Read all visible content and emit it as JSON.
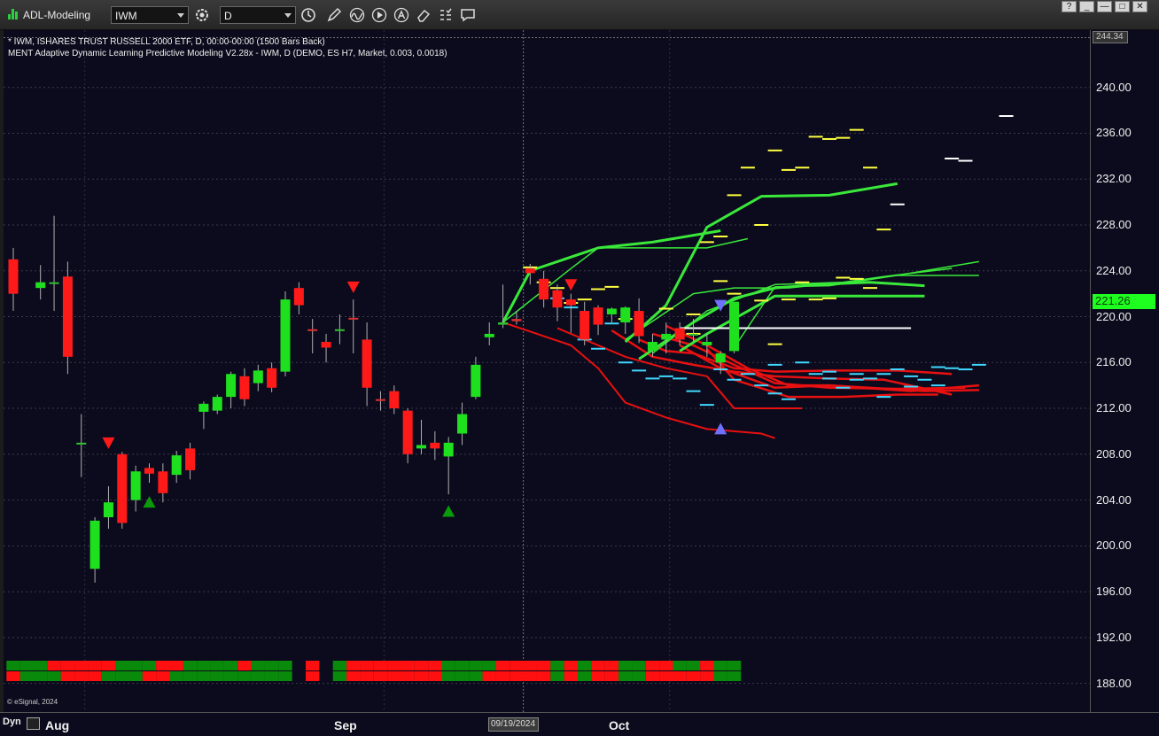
{
  "window": {
    "title": "ADL-Modeling",
    "symbol": "IWM",
    "interval": "D",
    "buttons": [
      "?",
      "_",
      "—",
      "□",
      "✕"
    ]
  },
  "colors": {
    "background": "#0b0b1d",
    "up": "#1fe01f",
    "down": "#ff1a1a",
    "forecast_high": "#ffff40",
    "forecast_low": "#40d8ff",
    "forecast_line_up": "#3ae83a",
    "forecast_line_down": "#e81010",
    "signal_up": "#0a9a0a",
    "signal_down": "#ff1a1a",
    "signal_blue": "#7070ff"
  },
  "legend": {
    "line1": "* IWM, ISHARES TRUST RUSSELL 2000 ETF, D, 00:00-00:00 (1500 Bars Back)",
    "line2": "MENT Adaptive Dynamic Learning Predictive Modeling V2.28x - IWM, D (DEMO, ES H7, Market, 0.003, 0.0018)"
  },
  "price_axis": {
    "top_label": "244.34",
    "last_price": "221.26",
    "ticks": [
      "240.00",
      "236.00",
      "232.00",
      "228.00",
      "224.00",
      "220.00",
      "216.00",
      "212.00",
      "208.00",
      "204.00",
      "200.00",
      "196.00",
      "192.00",
      "188.00"
    ]
  },
  "time_axis": {
    "dyn": "Dyn",
    "labels": [
      "Aug",
      "Sep",
      "Oct"
    ],
    "crosshair_date": "09/19/2024"
  },
  "copyright": "© eSignal, 2024",
  "chart_data": {
    "type": "candlestick",
    "ylim": [
      185.5,
      245
    ],
    "bar_count": 54,
    "candles": [
      [
        0,
        225.0,
        226.0,
        220.5,
        222.0
      ],
      [
        2,
        222.5,
        224.5,
        221.5,
        223.0
      ],
      [
        3,
        223.0,
        228.8,
        220.5,
        223.0
      ],
      [
        4,
        223.5,
        224.8,
        215.0,
        216.5
      ],
      [
        5,
        209.0,
        211.5,
        206.0,
        209.0
      ],
      [
        6,
        198.0,
        202.5,
        196.8,
        202.2
      ],
      [
        7,
        202.5,
        205.2,
        201.5,
        203.8
      ],
      [
        8,
        208.0,
        208.2,
        201.5,
        202.0
      ],
      [
        9,
        204.0,
        207.0,
        203.0,
        206.5
      ],
      [
        10,
        206.8,
        207.2,
        205.5,
        206.3
      ],
      [
        11,
        206.5,
        207.2,
        203.8,
        204.6
      ],
      [
        12,
        206.2,
        208.3,
        205.5,
        207.9
      ],
      [
        13,
        208.5,
        209.0,
        205.8,
        206.6
      ],
      [
        14,
        211.7,
        212.6,
        210.2,
        212.4
      ],
      [
        15,
        211.8,
        213.2,
        211.5,
        213.0
      ],
      [
        16,
        213.0,
        215.2,
        212.0,
        215.0
      ],
      [
        17,
        214.8,
        215.5,
        212.2,
        212.8
      ],
      [
        18,
        214.2,
        215.8,
        213.5,
        215.3
      ],
      [
        19,
        215.5,
        216.0,
        213.4,
        213.8
      ],
      [
        20,
        215.2,
        222.2,
        214.8,
        221.5
      ],
      [
        21,
        222.5,
        223.0,
        220.2,
        221.0
      ],
      [
        22,
        218.9,
        219.8,
        216.8,
        218.8
      ],
      [
        23,
        217.8,
        218.5,
        216.0,
        217.3
      ],
      [
        24,
        218.8,
        220.2,
        217.6,
        218.9
      ],
      [
        25,
        219.9,
        221.5,
        216.8,
        219.8
      ],
      [
        26,
        218.0,
        219.5,
        212.2,
        213.8
      ],
      [
        27,
        212.8,
        213.5,
        211.8,
        212.7
      ],
      [
        28,
        213.5,
        214.0,
        211.5,
        212.0
      ],
      [
        29,
        211.8,
        212.0,
        207.2,
        208.0
      ],
      [
        30,
        208.5,
        211.0,
        208.0,
        208.8
      ],
      [
        31,
        209.0,
        210.0,
        207.5,
        208.5
      ],
      [
        32,
        207.8,
        209.5,
        204.5,
        209.0
      ],
      [
        33,
        209.8,
        212.5,
        208.8,
        211.5
      ],
      [
        34,
        213.0,
        216.5,
        212.8,
        215.8
      ],
      [
        35,
        218.2,
        219.5,
        217.5,
        218.5
      ],
      [
        36,
        219.3,
        222.8,
        219.0,
        219.5
      ],
      [
        37,
        219.8,
        220.5,
        219.3,
        219.6
      ],
      [
        38,
        224.2,
        224.6,
        222.8,
        223.8
      ],
      [
        39,
        223.3,
        224.0,
        220.8,
        221.5
      ],
      [
        40,
        222.3,
        222.8,
        219.6,
        220.8
      ],
      [
        41,
        221.5,
        222.0,
        218.6,
        221.0
      ],
      [
        42,
        220.5,
        221.3,
        217.5,
        218.0
      ],
      [
        43,
        220.8,
        221.0,
        218.4,
        219.3
      ],
      [
        44,
        220.2,
        220.8,
        219.5,
        220.7
      ],
      [
        45,
        219.5,
        220.9,
        218.5,
        220.8
      ],
      [
        46,
        220.5,
        221.6,
        217.7,
        218.3
      ],
      [
        47,
        217.0,
        218.5,
        216.5,
        217.8
      ],
      [
        48,
        218.0,
        219.5,
        216.8,
        218.5
      ],
      [
        49,
        219.0,
        219.5,
        217.5,
        218.0
      ],
      [
        50,
        218.5,
        219.8,
        217.8,
        218.5
      ],
      [
        51,
        217.5,
        218.5,
        216.5,
        217.8
      ],
      [
        52,
        216.0,
        217.0,
        215.0,
        216.8
      ],
      [
        53,
        217.0,
        221.3,
        216.8,
        221.3
      ]
    ],
    "signals": [
      {
        "bar": 7,
        "price": 209.0,
        "dir": "down"
      },
      {
        "bar": 10,
        "price": 203.8,
        "dir": "up"
      },
      {
        "bar": 25,
        "price": 222.6,
        "dir": "down"
      },
      {
        "bar": 32,
        "price": 203.0,
        "dir": "up"
      },
      {
        "bar": 41,
        "price": 222.8,
        "dir": "down"
      },
      {
        "bar": 52,
        "price": 221.0,
        "dir": "down-blue"
      },
      {
        "bar": 52,
        "price": 210.2,
        "dir": "up-blue"
      }
    ],
    "forecast_lines_up": [
      [
        [
          36,
          219.5
        ],
        [
          38,
          224.0
        ],
        [
          43,
          226.0
        ],
        [
          47,
          226.5
        ],
        [
          52,
          227.5
        ]
      ],
      [
        [
          36,
          219.5
        ],
        [
          41,
          224.2
        ],
        [
          43,
          226.0
        ],
        [
          51,
          226.0
        ],
        [
          54,
          226.8
        ]
      ],
      [
        [
          45,
          217.8
        ],
        [
          48,
          221.0
        ],
        [
          51,
          227.8
        ],
        [
          55,
          230.5
        ],
        [
          60,
          230.6
        ],
        [
          65,
          231.6
        ]
      ],
      [
        [
          45,
          218.0
        ],
        [
          50,
          222.0
        ],
        [
          53,
          222.5
        ],
        [
          57,
          222.5
        ],
        [
          61,
          223.0
        ],
        [
          64,
          223.5
        ],
        [
          69,
          224.2
        ]
      ],
      [
        [
          46,
          216.3
        ],
        [
          50,
          219.5
        ],
        [
          53,
          221.6
        ],
        [
          56,
          222.5
        ],
        [
          59,
          222.8
        ],
        [
          63,
          223.0
        ],
        [
          67,
          222.7
        ]
      ],
      [
        [
          47,
          216.8
        ],
        [
          51,
          220.5
        ],
        [
          56,
          222.8
        ],
        [
          61,
          223.0
        ],
        [
          65,
          223.6
        ],
        [
          71,
          223.6
        ]
      ],
      [
        [
          49,
          217.0
        ],
        [
          51,
          218.5
        ],
        [
          56,
          221.8
        ],
        [
          63,
          221.8
        ],
        [
          67,
          221.8
        ]
      ],
      [
        [
          53,
          217.3
        ],
        [
          56,
          222.6
        ],
        [
          60,
          222.7
        ],
        [
          65,
          223.6
        ],
        [
          71,
          224.8
        ]
      ]
    ],
    "forecast_lines_down": [
      [
        [
          36,
          219.5
        ],
        [
          38,
          218.7
        ],
        [
          41,
          217.5
        ],
        [
          43,
          215.5
        ],
        [
          45,
          212.5
        ],
        [
          48,
          211.2
        ],
        [
          51,
          210.2
        ],
        [
          55,
          209.8
        ],
        [
          56,
          209.4
        ]
      ],
      [
        [
          40,
          219.0
        ],
        [
          42,
          218.0
        ],
        [
          45,
          216.5
        ],
        [
          48,
          215.5
        ],
        [
          51,
          214.8
        ],
        [
          53,
          212.0
        ],
        [
          55,
          212.0
        ],
        [
          58,
          212.0
        ]
      ],
      [
        [
          44,
          218.8
        ],
        [
          47,
          216.5
        ],
        [
          50,
          215.8
        ],
        [
          53,
          215.2
        ],
        [
          56,
          214.8
        ],
        [
          60,
          214.6
        ],
        [
          64,
          214.5
        ],
        [
          69,
          213.2
        ]
      ],
      [
        [
          46,
          218.0
        ],
        [
          48,
          217.0
        ],
        [
          50,
          216.8
        ],
        [
          53,
          215.5
        ],
        [
          56,
          215.2
        ],
        [
          60,
          215.3
        ],
        [
          65,
          215.3
        ],
        [
          69,
          215.0
        ]
      ],
      [
        [
          47,
          218.5
        ],
        [
          50,
          217.5
        ],
        [
          53,
          215.8
        ],
        [
          56,
          214.2
        ],
        [
          60,
          213.8
        ],
        [
          65,
          213.7
        ],
        [
          70,
          213.8
        ]
      ],
      [
        [
          48,
          219.2
        ],
        [
          51,
          217.5
        ],
        [
          54,
          215.5
        ],
        [
          57,
          214.0
        ],
        [
          60,
          214.0
        ],
        [
          66,
          213.5
        ],
        [
          71,
          214.0
        ]
      ],
      [
        [
          49,
          217.5
        ],
        [
          52,
          215.5
        ],
        [
          56,
          213.8
        ],
        [
          60,
          214.0
        ],
        [
          67,
          213.5
        ],
        [
          71,
          213.6
        ]
      ],
      [
        [
          51,
          217.2
        ],
        [
          53,
          214.5
        ],
        [
          57,
          213.0
        ],
        [
          61,
          213.0
        ],
        [
          65,
          213.2
        ],
        [
          68,
          213.2
        ]
      ]
    ],
    "forecast_high_dashes": [
      [
        38,
        224.3
      ],
      [
        39,
        223.0
      ],
      [
        40,
        222.5
      ],
      [
        41,
        221.2
      ],
      [
        42,
        221.5
      ],
      [
        43,
        222.4
      ],
      [
        44,
        222.6
      ],
      [
        45,
        219.8
      ],
      [
        48,
        220.7
      ],
      [
        50,
        218.5
      ],
      [
        51,
        226.5
      ],
      [
        52,
        227.0
      ],
      [
        53,
        230.6
      ],
      [
        54,
        233.0
      ],
      [
        55,
        228.0
      ],
      [
        56,
        234.5
      ],
      [
        57,
        232.8
      ],
      [
        58,
        233.0
      ],
      [
        59,
        235.7
      ],
      [
        60,
        235.5
      ],
      [
        61,
        235.6
      ],
      [
        62,
        236.3
      ],
      [
        63,
        233.0
      ],
      [
        64,
        227.6
      ],
      [
        52,
        223.1
      ],
      [
        53,
        222.0
      ],
      [
        55,
        221.4
      ],
      [
        56,
        217.6
      ],
      [
        57,
        221.5
      ],
      [
        58,
        223.0
      ],
      [
        59,
        221.5
      ],
      [
        60,
        221.6
      ],
      [
        61,
        223.4
      ],
      [
        62,
        223.3
      ],
      [
        63,
        222.5
      ],
      [
        50,
        220.2
      ]
    ],
    "forecast_low_dashes": [
      [
        40,
        221.6
      ],
      [
        41,
        220.8
      ],
      [
        42,
        218.0
      ],
      [
        43,
        217.2
      ],
      [
        44,
        219.4
      ],
      [
        45,
        216.0
      ],
      [
        46,
        215.3
      ],
      [
        47,
        214.6
      ],
      [
        48,
        214.8
      ],
      [
        49,
        214.6
      ],
      [
        50,
        213.5
      ],
      [
        51,
        212.3
      ],
      [
        52,
        215.4
      ],
      [
        53,
        214.5
      ],
      [
        54,
        215.0
      ],
      [
        55,
        214.0
      ],
      [
        56,
        213.3
      ],
      [
        57,
        212.8
      ],
      [
        58,
        216.0
      ],
      [
        59,
        215.0
      ],
      [
        60,
        214.6
      ],
      [
        61,
        213.8
      ],
      [
        62,
        215.0
      ],
      [
        63,
        214.6
      ],
      [
        64,
        213.0
      ],
      [
        65,
        215.4
      ],
      [
        66,
        214.8
      ],
      [
        67,
        214.5
      ],
      [
        68,
        214.0
      ],
      [
        69,
        215.5
      ],
      [
        70,
        215.4
      ],
      [
        71,
        215.8
      ],
      [
        56,
        215.8
      ],
      [
        60,
        215.2
      ],
      [
        64,
        215.0
      ],
      [
        68,
        215.6
      ],
      [
        62,
        214.5
      ],
      [
        66,
        213.9
      ]
    ],
    "white_dashes": [
      [
        65,
        229.8
      ],
      [
        69,
        233.8
      ],
      [
        70,
        233.6
      ],
      [
        73,
        237.5
      ]
    ],
    "white_hline": {
      "from": 49,
      "to": 66,
      "price": 219.0
    },
    "cursor_bar": 37.5,
    "bottom_strip": [
      {
        "bar": 0,
        "a": "g",
        "b": "r"
      },
      {
        "bar": 1,
        "a": "g",
        "b": "g"
      },
      {
        "bar": 2,
        "a": "g",
        "b": "g"
      },
      {
        "bar": 3,
        "a": "r",
        "b": "g"
      },
      {
        "bar": 4,
        "a": "r",
        "b": "r"
      },
      {
        "bar": 5,
        "a": "r",
        "b": "r"
      },
      {
        "bar": 6,
        "a": "r",
        "b": "r"
      },
      {
        "bar": 7,
        "a": "r",
        "b": "g"
      },
      {
        "bar": 8,
        "a": "g",
        "b": "g"
      },
      {
        "bar": 9,
        "a": "g",
        "b": "g"
      },
      {
        "bar": 10,
        "a": "g",
        "b": "r"
      },
      {
        "bar": 11,
        "a": "r",
        "b": "r"
      },
      {
        "bar": 12,
        "a": "r",
        "b": "g"
      },
      {
        "bar": 13,
        "a": "g",
        "b": "g"
      },
      {
        "bar": 14,
        "a": "g",
        "b": "g"
      },
      {
        "bar": 15,
        "a": "g",
        "b": "g"
      },
      {
        "bar": 16,
        "a": "g",
        "b": "g"
      },
      {
        "bar": 17,
        "a": "r",
        "b": "g"
      },
      {
        "bar": 18,
        "a": "g",
        "b": "g"
      },
      {
        "bar": 19,
        "a": "g",
        "b": "g"
      },
      {
        "bar": 20,
        "a": "g",
        "b": "g"
      },
      {
        "bar": 22,
        "a": "r",
        "b": "r"
      },
      {
        "bar": 24,
        "a": "g",
        "b": "g"
      },
      {
        "bar": 25,
        "a": "r",
        "b": "r"
      },
      {
        "bar": 26,
        "a": "r",
        "b": "r"
      },
      {
        "bar": 27,
        "a": "r",
        "b": "r"
      },
      {
        "bar": 28,
        "a": "r",
        "b": "r"
      },
      {
        "bar": 29,
        "a": "r",
        "b": "r"
      },
      {
        "bar": 30,
        "a": "r",
        "b": "r"
      },
      {
        "bar": 31,
        "a": "r",
        "b": "r"
      },
      {
        "bar": 32,
        "a": "g",
        "b": "g"
      },
      {
        "bar": 33,
        "a": "g",
        "b": "g"
      },
      {
        "bar": 34,
        "a": "g",
        "b": "g"
      },
      {
        "bar": 35,
        "a": "g",
        "b": "r"
      },
      {
        "bar": 36,
        "a": "r",
        "b": "r"
      },
      {
        "bar": 37,
        "a": "r",
        "b": "r"
      },
      {
        "bar": 38,
        "a": "r",
        "b": "r"
      },
      {
        "bar": 39,
        "a": "r",
        "b": "r"
      },
      {
        "bar": 40,
        "a": "g",
        "b": "g"
      },
      {
        "bar": 41,
        "a": "r",
        "b": "r"
      },
      {
        "bar": 42,
        "a": "g",
        "b": "g"
      },
      {
        "bar": 43,
        "a": "r",
        "b": "r"
      },
      {
        "bar": 44,
        "a": "r",
        "b": "r"
      },
      {
        "bar": 45,
        "a": "g",
        "b": "g"
      },
      {
        "bar": 46,
        "a": "g",
        "b": "g"
      },
      {
        "bar": 47,
        "a": "r",
        "b": "r"
      },
      {
        "bar": 48,
        "a": "r",
        "b": "r"
      },
      {
        "bar": 49,
        "a": "g",
        "b": "r"
      },
      {
        "bar": 50,
        "a": "g",
        "b": "r"
      },
      {
        "bar": 51,
        "a": "r",
        "b": "r"
      },
      {
        "bar": 52,
        "a": "g",
        "b": "g"
      },
      {
        "bar": 53,
        "a": "g",
        "b": "g"
      }
    ]
  }
}
